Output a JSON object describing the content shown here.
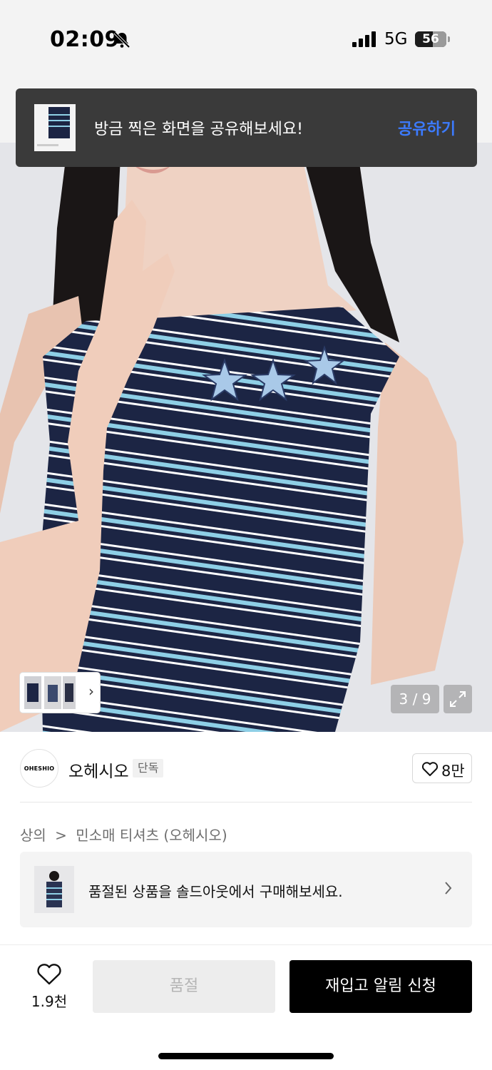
{
  "status_bar": {
    "time": "02:09",
    "network": "5G",
    "battery": "56",
    "battery_level": 0.56
  },
  "toast": {
    "message": "방금 찍은 화면을 공유해보세요!",
    "action": "공유하기"
  },
  "gallery": {
    "pager": "3 / 9",
    "current": 3,
    "total": 9
  },
  "brand": {
    "logo_text": "OHESHIO",
    "name": "오헤시오",
    "badge": "단독",
    "likes": "8만"
  },
  "breadcrumb": {
    "category": "상의",
    "separator": ">",
    "subcategory": "민소매 티셔츠 (오헤시오)"
  },
  "soldout_banner": {
    "text": "품절된 상품을 솔드아웃에서 구매해보세요."
  },
  "bottom_bar": {
    "wish_count": "1.9천",
    "soldout_label": "품절",
    "restock_label": "재입고 알림 신청"
  },
  "colors": {
    "accent_link": "#3c7bff",
    "toast_bg": "#3a3a3a",
    "stripe_navy": "#1c2544",
    "stripe_sky": "#8ecfe6"
  },
  "icons": [
    "bell-off-icon",
    "signal-icon",
    "battery-icon",
    "expand-icon",
    "heart-icon",
    "chevron-right-icon"
  ]
}
